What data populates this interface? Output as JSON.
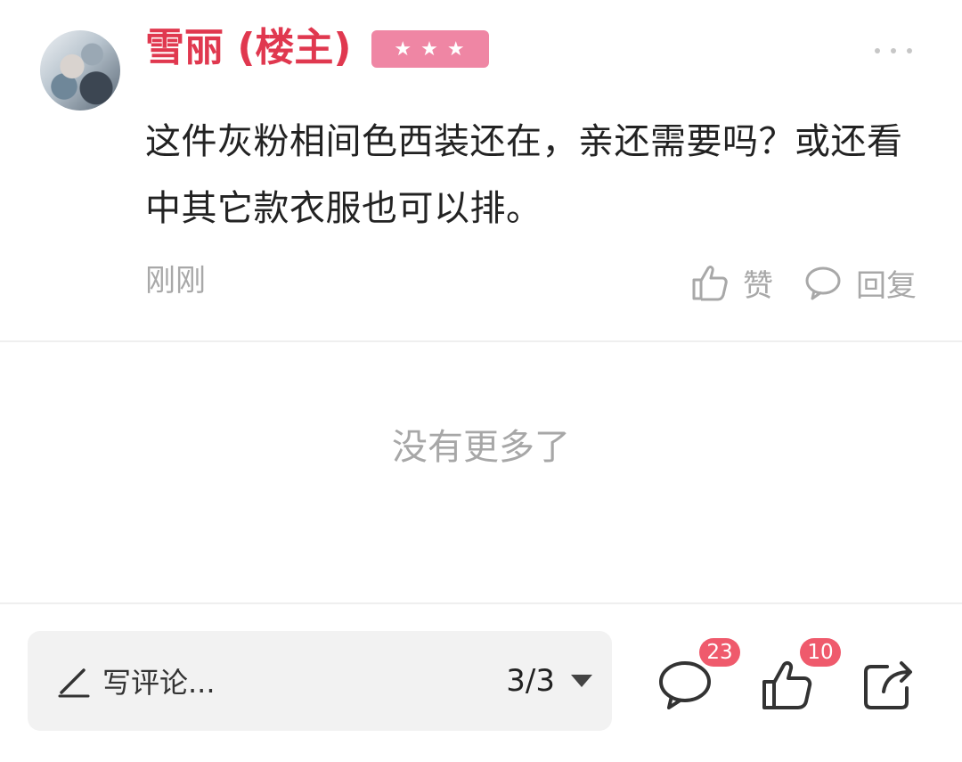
{
  "comment": {
    "author": "雪丽 (楼主)",
    "rank_badge": "★★★",
    "text": "这件灰粉相间色西装还在，亲还需要吗？或还看中其它款衣服也可以排。",
    "time": "刚刚",
    "like_label": "赞",
    "reply_label": "回复"
  },
  "footer": {
    "no_more": "没有更多了"
  },
  "bottom_bar": {
    "comment_placeholder": "写评论...",
    "page": "3/3",
    "comment_count": "23",
    "like_count": "10"
  },
  "icons": {
    "more": "more-icon",
    "thumb_up": "thumbs-up-icon",
    "reply": "speech-bubble-icon",
    "pencil": "pencil-icon",
    "dropdown": "dropdown-arrow-icon",
    "comments": "comment-icon",
    "share": "share-icon"
  },
  "colors": {
    "author": "#e0384f",
    "rank_badge": "#ef86a4",
    "count_badge": "#ef5a6c",
    "muted_text": "#a8a8a8"
  }
}
